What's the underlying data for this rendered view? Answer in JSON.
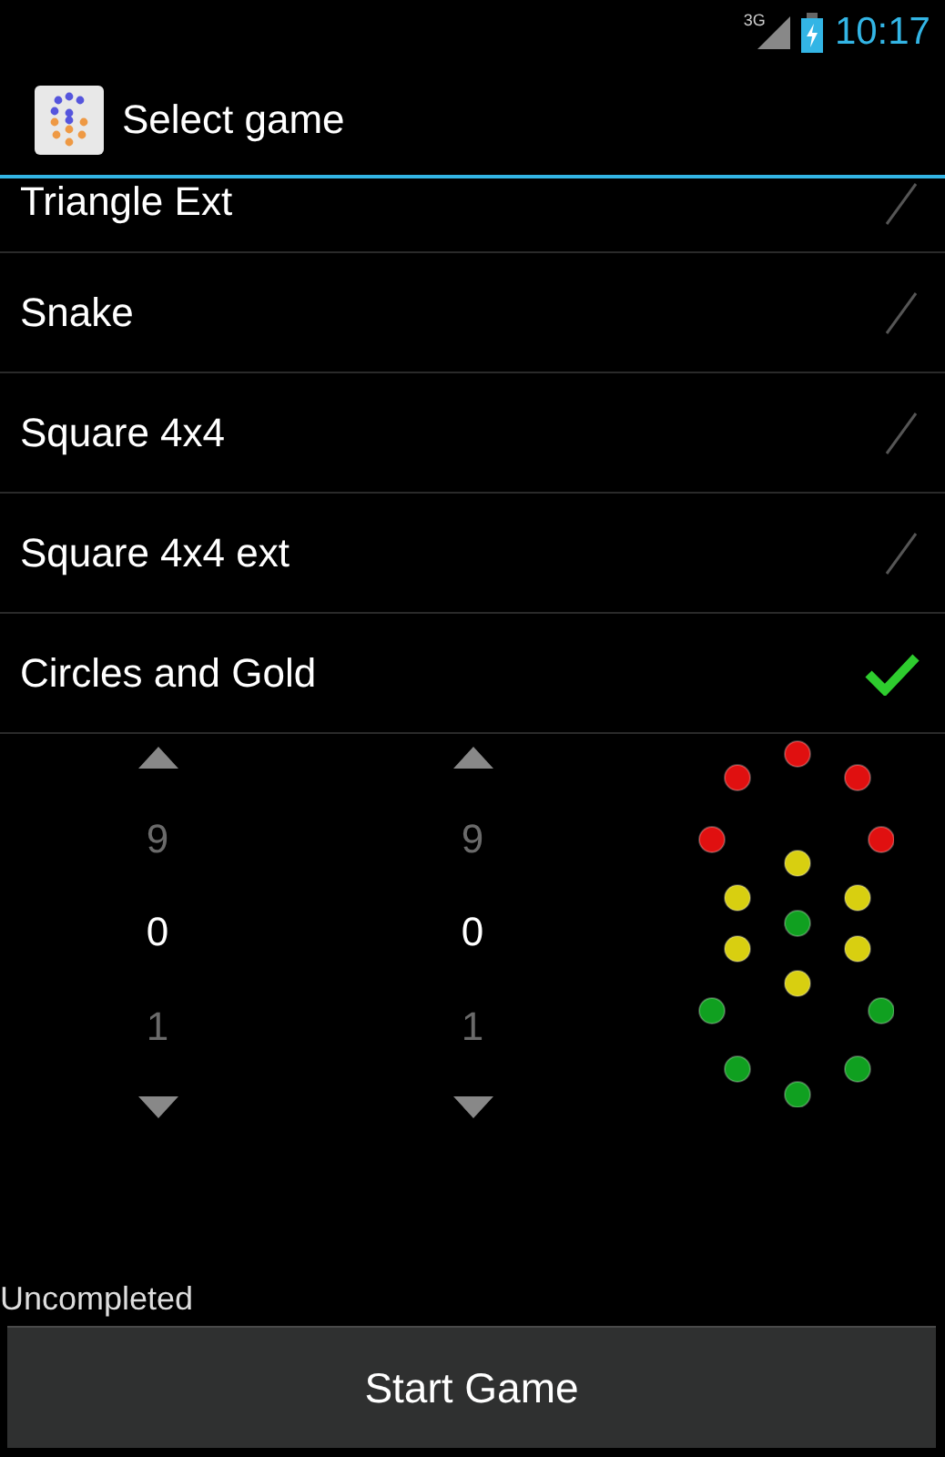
{
  "status_bar": {
    "network": "3G",
    "time": "10:17"
  },
  "action_bar": {
    "title": "Select game"
  },
  "games": [
    {
      "name": "Triangle Ext",
      "selected": false
    },
    {
      "name": "Snake",
      "selected": false
    },
    {
      "name": "Square 4x4",
      "selected": false
    },
    {
      "name": "Square 4x4 ext",
      "selected": false
    },
    {
      "name": "Circles and Gold",
      "selected": true
    }
  ],
  "pickers": [
    {
      "above": "9",
      "value": "0",
      "below": "1"
    },
    {
      "above": "9",
      "value": "0",
      "below": "1"
    }
  ],
  "status": "Uncompleted",
  "start_button": "Start Game"
}
